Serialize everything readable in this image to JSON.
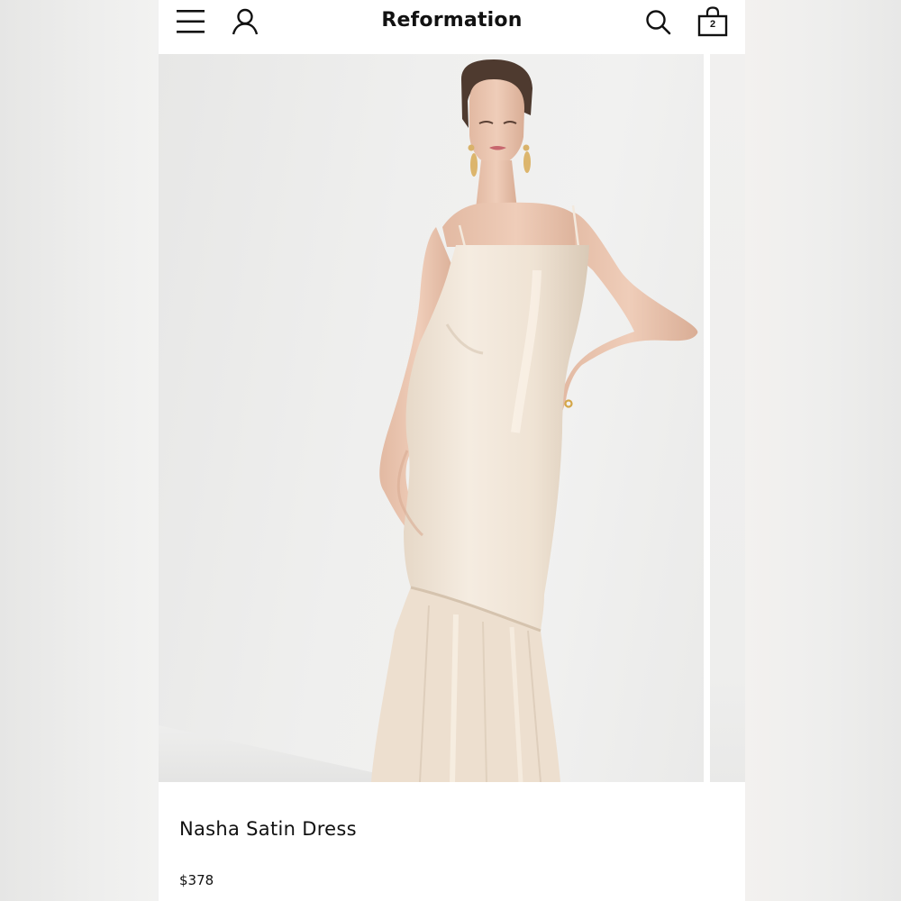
{
  "header": {
    "brand": "Reformation",
    "cart_count": "2",
    "icons": {
      "menu": "hamburger-menu-icon",
      "account": "user-account-icon",
      "search": "search-icon",
      "cart": "shopping-bag-icon"
    }
  },
  "product": {
    "name": "Nasha Satin Dress",
    "price": "$378",
    "image_alt": "Model wearing a champagne satin slip maxi dress with a ruffled hem"
  },
  "colors": {
    "dress": "#efe3d4",
    "background": "#ffffff",
    "text": "#111111"
  }
}
